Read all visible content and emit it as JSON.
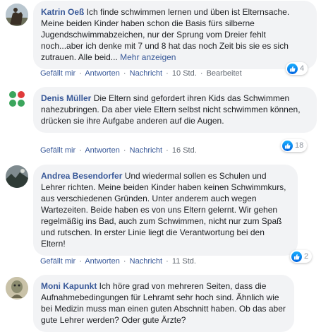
{
  "comments": [
    {
      "author": "Katrin Oeß",
      "text": "Ich finde schwimmen lernen und üben ist Elternsache. Meine beiden Kinder haben schon die Basis fürs silberne Jugendschwimmabzeichen, nur der Sprung vom Dreier fehlt noch...aber ich denke mit 7 und 8 hat das noch Zeit bis sie es sich zutrauen. Alle beid...",
      "more": "Mehr anzeigen",
      "reactions": "4",
      "time": "10 Std.",
      "edited": "Bearbeitet"
    },
    {
      "author": "Denis Müller",
      "text": "Die Eltern sind gefordert ihren Kids das Schwimmen nahezubringen. Da aber viele Eltern selbst nicht schwimmen können, drücken sie ihre Aufgabe anderen auf die Augen.",
      "reactions": "18",
      "time": "16 Std."
    },
    {
      "author": "Andrea Besendorfer",
      "text": "Und wiedermal sollen es Schulen und Lehrer richten. Meine beiden Kinder haben keinen Schwimmkurs, aus verschiedenen Gründen. Unter anderem auch wegen Wartezeiten. Beide haben es von uns Eltern gelernt. Wir gehen regelmäßig ins Bad, auch zum Schwimmen, nicht nur zum Spaß und rutschen. In erster Linie liegt die Verantwortung bei den Eltern!",
      "reactions": "2",
      "time": "11 Std."
    },
    {
      "author": "Moni Kapunkt",
      "text": "Ich höre grad von mehreren Seiten, dass die Aufnahmebedingungen für Lehramt sehr hoch sind. Ähnlich wie bei Medizin muss man einen guten Abschnitt haben. Ob das aber gute Lehrer werden? Oder gute Ärzte?"
    }
  ],
  "actions": {
    "like": "Gefällt mir",
    "reply": "Antworten",
    "message": "Nachricht",
    "separator": "·"
  },
  "icons": {
    "like": "thumbs-up-icon"
  },
  "colors": {
    "author": "#385898",
    "bubble": "#f2f3f5",
    "meta": "#606770",
    "like_badge": "#1877f2"
  }
}
